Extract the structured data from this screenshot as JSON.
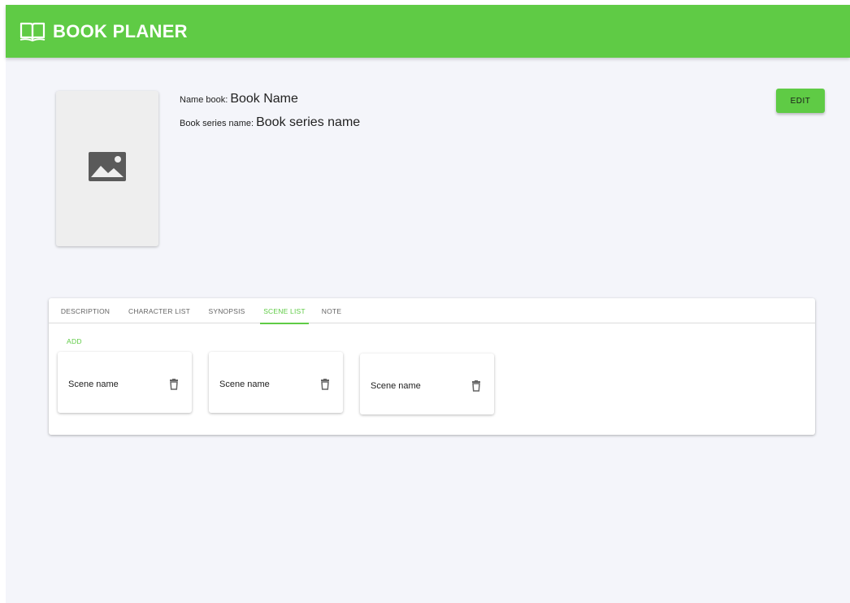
{
  "app": {
    "title": "BOOK PLANER",
    "logo_icon": "open-book-icon",
    "accent_color": "#5fcb45"
  },
  "book": {
    "cover_icon": "image-placeholder-icon",
    "name_label": "Name book:",
    "name_value": "Book Name",
    "series_label": "Book series name:",
    "series_value": "Book series name",
    "edit_label": "EDIT"
  },
  "tabs": [
    {
      "label": "DESCRIPTION",
      "active": false
    },
    {
      "label": "CHARACTER LIST",
      "active": false
    },
    {
      "label": "SYNOPSIS",
      "active": false
    },
    {
      "label": "SCENE LIST",
      "active": true
    },
    {
      "label": "NOTE",
      "active": false
    }
  ],
  "scene_list": {
    "add_label": "ADD",
    "scenes": [
      {
        "name": "Scene name",
        "delete_icon": "trash-icon"
      },
      {
        "name": "Scene name",
        "delete_icon": "trash-icon"
      },
      {
        "name": "Scene name",
        "delete_icon": "trash-icon"
      }
    ]
  }
}
